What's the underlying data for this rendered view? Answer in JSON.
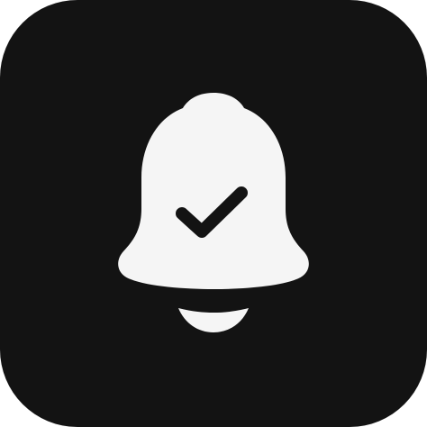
{
  "app_icon": {
    "icon": "bell-check-icon",
    "background_color": "#131313",
    "glyph_color": "#f5f5f5",
    "check_color": "#131313"
  }
}
